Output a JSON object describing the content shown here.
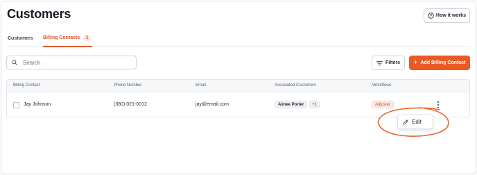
{
  "header": {
    "title": "Customers",
    "how_button_label": "How it works",
    "how_icon": "question-circle-icon"
  },
  "tabs": [
    {
      "label": "Customers",
      "active": false
    },
    {
      "label": "Billing Contacts",
      "count": "1",
      "active": true
    }
  ],
  "toolbar": {
    "search_placeholder": "Search",
    "search_value": "",
    "filters_label": "Filters",
    "add_label": "Add Billing Contact",
    "add_icon": "plus-icon"
  },
  "table": {
    "columns": [
      "Billing Contact",
      "Phone Number",
      "Email",
      "Associated Customers",
      "Workflows"
    ],
    "rows": [
      {
        "name": "Jay Johnson",
        "phone": "(380) 021-0012",
        "email": "jay@email.com",
        "customer": "Aimee Porter",
        "more_customers": "+1",
        "workflow": "Adjuster"
      }
    ]
  },
  "row_menu": {
    "edit_label": "Edit",
    "edit_icon": "pencil-icon"
  },
  "colors": {
    "accent": "#ec5a24",
    "annotation": "#e8662a",
    "text": "#1f2330"
  }
}
